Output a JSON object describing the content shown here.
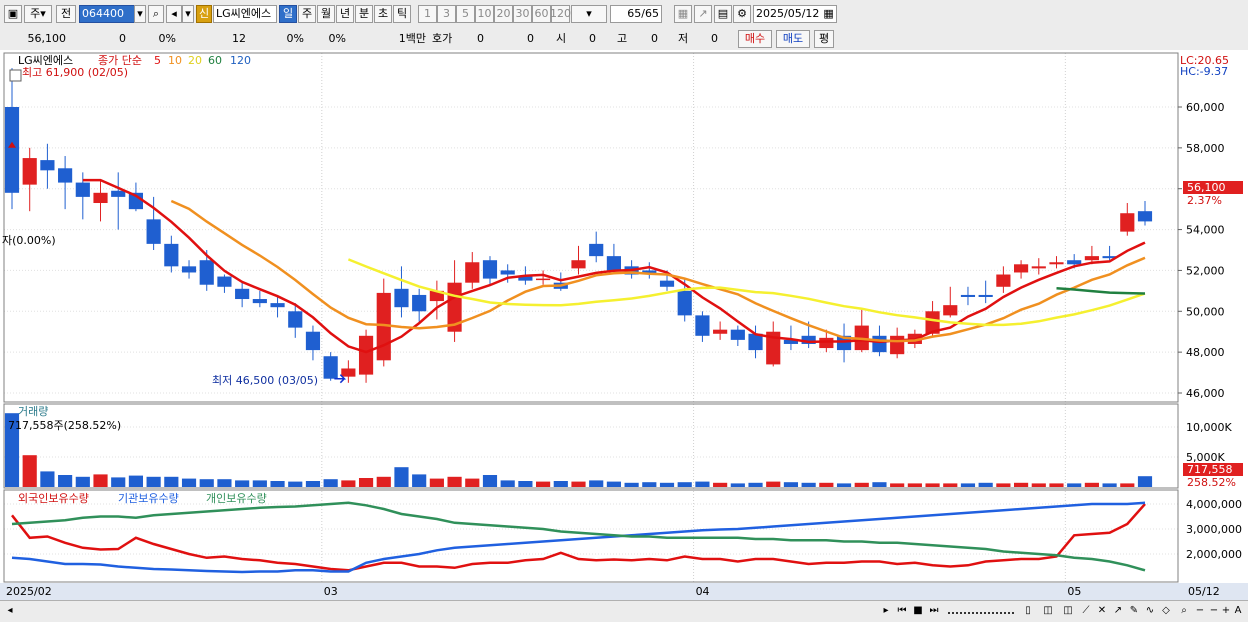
{
  "toolbar": {
    "market": "주",
    "prev_label": "전",
    "code": "064400",
    "stock_name": "LG씨엔에스",
    "period_tabs": [
      "일",
      "주",
      "월",
      "년",
      "분",
      "초",
      "틱"
    ],
    "period_active": "일",
    "interval_tabs": [
      "1",
      "3",
      "5",
      "10",
      "20",
      "30",
      "60",
      "120"
    ],
    "count": "65",
    "count_total": "/65",
    "date": "2025/05/12",
    "credit_label": "신"
  },
  "infobar": {
    "price": "56,100",
    "change": "0",
    "change_pct": "0%",
    "volume": "12",
    "vol_pct": "0%",
    "vol_pct2": "0%",
    "unit": "1백만",
    "quote_label": "호가",
    "quote_v1": "0",
    "quote_v2": "0",
    "open_label": "시",
    "open_v": "0",
    "high_label": "고",
    "high_v": "0",
    "low_label": "저",
    "low_v": "0",
    "buy_button": "매수",
    "sell_button": "매도",
    "eval_button": "평"
  },
  "price_panel": {
    "legend_name": "LG씨엔에스",
    "legend_indicator": "종가 단순",
    "ma_periods": [
      "5",
      "10",
      "20",
      "60",
      "120"
    ],
    "max_annotation": "최고 61,900 (02/05)",
    "min_annotation": "최저 46,500 (03/05)",
    "left_side_label": "자(0.00%)",
    "lc_label": "LC:20.65",
    "hc_label": "HC:-9.37",
    "current_price_tag": "56,100",
    "current_pct_tag": "2.37%",
    "y_ticks": [
      "60,000",
      "58,000",
      "56,000",
      "54,000",
      "52,000",
      "50,000",
      "48,000",
      "46,000"
    ]
  },
  "volume_panel": {
    "title": "거래량",
    "summary": "717,558주(258.52%)",
    "y_ticks": [
      "10,000K",
      "5,000K"
    ],
    "current_tag": "717,558",
    "current_pct": "258.52%"
  },
  "holdings_panel": {
    "legend": [
      "외국인보유수량",
      "기관보유수량",
      "개인보유수량"
    ],
    "y_ticks": [
      "4,000,000",
      "3,000,000",
      "2,000,000"
    ]
  },
  "x_axis": {
    "labels": [
      "2025/02",
      "03",
      "04",
      "05",
      "05/12"
    ]
  },
  "colors": {
    "up": "#e02020",
    "down": "#1f5fd0",
    "ma5": "#e01010",
    "ma10": "#f09020",
    "ma20": "#f5f030",
    "ma60": "#208040",
    "foreign": "#e01010",
    "institution": "#2060e0",
    "individual": "#30905a"
  },
  "chart_data": [
    {
      "type": "candlestick",
      "dates": [
        "02/05",
        "02/06",
        "02/07",
        "02/10",
        "02/11",
        "02/12",
        "02/13",
        "02/14",
        "02/17",
        "02/18",
        "02/19",
        "02/20",
        "02/21",
        "02/24",
        "02/25",
        "02/26",
        "02/27",
        "02/28",
        "03/04",
        "03/05",
        "03/06",
        "03/07",
        "03/10",
        "03/11",
        "03/12",
        "03/13",
        "03/14",
        "03/17",
        "03/18",
        "03/19",
        "03/20",
        "03/21",
        "03/24",
        "03/25",
        "03/26",
        "03/27",
        "03/28",
        "03/31",
        "04/01",
        "04/02",
        "04/03",
        "04/04",
        "04/07",
        "04/08",
        "04/09",
        "04/10",
        "04/11",
        "04/14",
        "04/15",
        "04/16",
        "04/17",
        "04/18",
        "04/21",
        "04/22",
        "04/23",
        "04/24",
        "04/25",
        "04/28",
        "04/29",
        "04/30",
        "05/02",
        "05/07",
        "05/08",
        "05/09",
        "05/12"
      ],
      "open": [
        60000,
        56200,
        57400,
        57000,
        56300,
        55300,
        55900,
        55800,
        54500,
        53300,
        52200,
        52500,
        51700,
        51100,
        50600,
        50400,
        50000,
        49000,
        47800,
        46800,
        46900,
        47600,
        51100,
        50800,
        50500,
        49000,
        51400,
        52500,
        52000,
        51700,
        51600,
        51400,
        52100,
        53300,
        52700,
        52200,
        52000,
        51500,
        51000,
        49800,
        48900,
        49100,
        48900,
        47400,
        48600,
        48800,
        48200,
        48800,
        48100,
        48800,
        47900,
        48400,
        48900,
        49800,
        50800,
        50800,
        51200,
        51900,
        52100,
        52300,
        52500,
        52500,
        52700,
        53900,
        54900
      ],
      "close": [
        55800,
        57500,
        56900,
        56300,
        55600,
        55800,
        55600,
        55000,
        53300,
        52200,
        51900,
        51300,
        51200,
        50600,
        50400,
        50200,
        49200,
        48100,
        46700,
        47200,
        48800,
        50900,
        50200,
        50000,
        51000,
        51400,
        52400,
        51600,
        51800,
        51500,
        51600,
        51100,
        52500,
        52700,
        52000,
        51800,
        51800,
        51200,
        49800,
        48800,
        49100,
        48600,
        48100,
        49000,
        48400,
        48400,
        48700,
        48100,
        49300,
        48000,
        48800,
        48900,
        50000,
        50300,
        50700,
        50700,
        51800,
        52300,
        52200,
        52400,
        52300,
        52700,
        52600,
        54800,
        54400
      ],
      "high": [
        61900,
        58000,
        58200,
        57600,
        56800,
        56400,
        56800,
        56300,
        55600,
        53700,
        52500,
        53000,
        51800,
        51400,
        51000,
        50700,
        50400,
        49300,
        48000,
        47600,
        49100,
        51600,
        52200,
        51100,
        51500,
        52500,
        52900,
        52700,
        52300,
        52200,
        52000,
        51900,
        53200,
        53900,
        53300,
        52500,
        52400,
        52000,
        51600,
        50000,
        49500,
        49300,
        49300,
        49500,
        49300,
        49500,
        49100,
        49400,
        50100,
        49300,
        49200,
        49100,
        50500,
        51200,
        51200,
        51500,
        52200,
        52500,
        52600,
        52700,
        52800,
        53200,
        53200,
        55300,
        55400
      ],
      "low": [
        55000,
        54900,
        56000,
        55000,
        54500,
        54400,
        54000,
        54900,
        53000,
        51900,
        51600,
        51000,
        50900,
        50200,
        50200,
        49700,
        48700,
        47600,
        46600,
        46500,
        46500,
        47300,
        49700,
        49500,
        49600,
        48500,
        51100,
        51300,
        51400,
        51300,
        51300,
        51000,
        51800,
        52400,
        51900,
        51600,
        51600,
        51000,
        49500,
        48500,
        48600,
        48300,
        47700,
        47300,
        48100,
        48200,
        48000,
        47500,
        48000,
        47800,
        47700,
        48200,
        48800,
        49700,
        50300,
        50400,
        50900,
        51600,
        51800,
        52100,
        52100,
        52300,
        52500,
        53700,
        54200
      ]
    },
    {
      "type": "bar",
      "title": "거래량",
      "unit": "K",
      "values": [
        12300,
        5300,
        2600,
        2000,
        1700,
        2100,
        1600,
        1900,
        1700,
        1700,
        1400,
        1300,
        1300,
        1100,
        1100,
        1000,
        900,
        1000,
        1300,
        1100,
        1500,
        1700,
        3300,
        2100,
        1400,
        1700,
        1400,
        2000,
        1100,
        1000,
        900,
        1000,
        900,
        1100,
        900,
        700,
        800,
        700,
        800,
        900,
        700,
        600,
        700,
        900,
        800,
        700,
        700,
        600,
        700,
        800,
        600,
        600,
        600,
        600,
        600,
        700,
        600,
        700,
        600,
        600,
        600,
        700,
        600,
        600,
        1800
      ]
    },
    {
      "type": "line",
      "series": [
        {
          "name": "외국인보유수량",
          "values": [
            3550000,
            2650000,
            2700000,
            2450000,
            2250000,
            2180000,
            2200000,
            2650000,
            2400000,
            2200000,
            2000000,
            1850000,
            1900000,
            1800000,
            1750000,
            1650000,
            1600000,
            1500000,
            1400000,
            1350000,
            1500000,
            1650000,
            1650000,
            1500000,
            1500000,
            1450000,
            1600000,
            1650000,
            1650000,
            1750000,
            1800000,
            2050000,
            1800000,
            1750000,
            1780000,
            1750000,
            1800000,
            1750000,
            1900000,
            1800000,
            1800000,
            1700000,
            1800000,
            1800000,
            1700000,
            1600000,
            1650000,
            1650000,
            1700000,
            1700000,
            1600000,
            1650000,
            1550000,
            1500000,
            1550000,
            1700000,
            1750000,
            1800000,
            1800000,
            1900000,
            2750000,
            2800000,
            2850000,
            3200000,
            4000000
          ]
        },
        {
          "name": "기관보유수량",
          "values": [
            1850000,
            1800000,
            1700000,
            1600000,
            1600000,
            1580000,
            1500000,
            1450000,
            1400000,
            1380000,
            1350000,
            1320000,
            1300000,
            1280000,
            1300000,
            1300000,
            1350000,
            1350000,
            1300000,
            1300000,
            1650000,
            1800000,
            1900000,
            2000000,
            2150000,
            2250000,
            2300000,
            2350000,
            2400000,
            2450000,
            2500000,
            2550000,
            2600000,
            2650000,
            2700000,
            2750000,
            2800000,
            2850000,
            2900000,
            2950000,
            2980000,
            3000000,
            3050000,
            3100000,
            3150000,
            3200000,
            3250000,
            3300000,
            3350000,
            3400000,
            3450000,
            3500000,
            3550000,
            3600000,
            3650000,
            3700000,
            3750000,
            3800000,
            3850000,
            3900000,
            3950000,
            4000000,
            4000000,
            4000000,
            4050000
          ]
        },
        {
          "name": "개인보유수량",
          "values": [
            3200000,
            3250000,
            3300000,
            3350000,
            3450000,
            3500000,
            3500000,
            3450000,
            3550000,
            3600000,
            3650000,
            3700000,
            3750000,
            3800000,
            3850000,
            3880000,
            3900000,
            3950000,
            4000000,
            4050000,
            3950000,
            3800000,
            3600000,
            3500000,
            3400000,
            3250000,
            3200000,
            3150000,
            3100000,
            3050000,
            3000000,
            2900000,
            2850000,
            2800000,
            2750000,
            2700000,
            2700000,
            2650000,
            2650000,
            2650000,
            2650000,
            2650000,
            2600000,
            2600000,
            2550000,
            2550000,
            2550000,
            2500000,
            2500000,
            2450000,
            2450000,
            2400000,
            2350000,
            2300000,
            2250000,
            2200000,
            2100000,
            2050000,
            2000000,
            1950000,
            1850000,
            1800000,
            1700000,
            1550000,
            1350000
          ]
        }
      ]
    }
  ]
}
